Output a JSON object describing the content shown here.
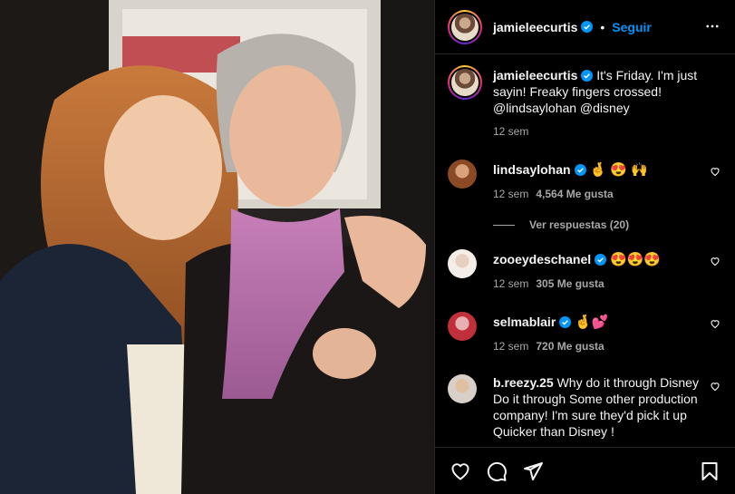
{
  "post": {
    "image_alt": "Two women posing together at an event"
  },
  "header": {
    "username": "jamieleecurtis",
    "separator": "•",
    "follow_label": "Seguir",
    "more_icon": "more-horizontal-icon"
  },
  "caption": {
    "username": "jamieleecurtis",
    "text": "It's Friday. I'm just sayin! Freaky fingers crossed! @lindsaylohan @disney",
    "time": "12 sem"
  },
  "comments": [
    {
      "username": "lindsaylohan",
      "verified": true,
      "text": "🤞 😍 🙌",
      "time": "12 sem",
      "likes": "4,564 Me gusta",
      "replies": "Ver respuestas (20)"
    },
    {
      "username": "zooeydeschanel",
      "verified": true,
      "text": "😍😍😍",
      "time": "12 sem",
      "likes": "305 Me gusta"
    },
    {
      "username": "selmablair",
      "verified": true,
      "text": "🤞💕",
      "time": "12 sem",
      "likes": "720 Me gusta"
    },
    {
      "username": "b.reezy.25",
      "verified": false,
      "text": "Why do it through Disney Do it through Some other production company! I'm sure they'd pick it up Quicker than Disney !"
    }
  ],
  "actions": {
    "like_icon": "heart-icon",
    "comment_icon": "comment-icon",
    "share_icon": "share-icon",
    "save_icon": "bookmark-icon"
  },
  "colors": {
    "background": "#000000",
    "text": "#f5f5f5",
    "secondary": "#a8a8a8",
    "link": "#0095f6",
    "verified": "#0095f6",
    "divider": "#262626"
  }
}
